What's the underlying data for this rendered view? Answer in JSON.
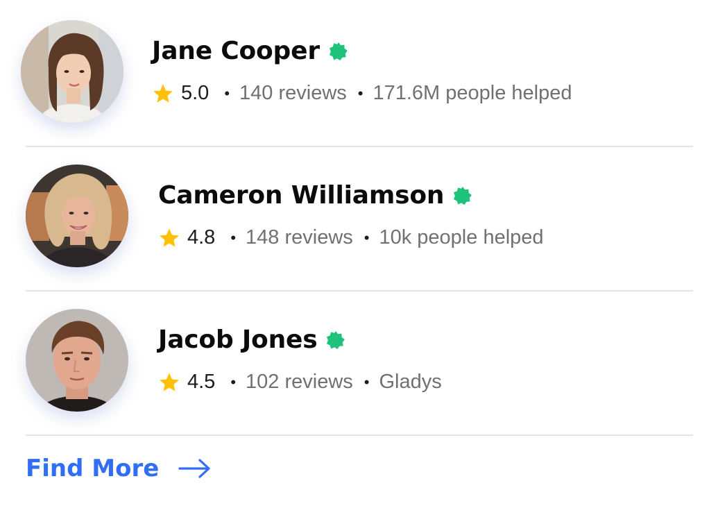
{
  "people": [
    {
      "name": "Jane Cooper",
      "rating": "5.0",
      "reviews": "140 reviews",
      "extra": "171.6M people helped",
      "verified": true
    },
    {
      "name": "Cameron Williamson",
      "rating": "4.8",
      "reviews": "148 reviews",
      "extra": "10k people helped",
      "verified": true
    },
    {
      "name": "Jacob Jones",
      "rating": "4.5",
      "reviews": "102 reviews",
      "extra": "Gladys",
      "verified": true
    }
  ],
  "separator": "•",
  "find_more": {
    "label": "Find More"
  },
  "colors": {
    "verified_badge": "#1ec27a",
    "star": "#ffc107",
    "link": "#2f6ef5",
    "divider": "#dde6f0",
    "muted_text": "#707070"
  },
  "icons": {
    "verified": "verified-badge-icon",
    "star": "star-icon",
    "arrow": "arrow-right-icon"
  }
}
